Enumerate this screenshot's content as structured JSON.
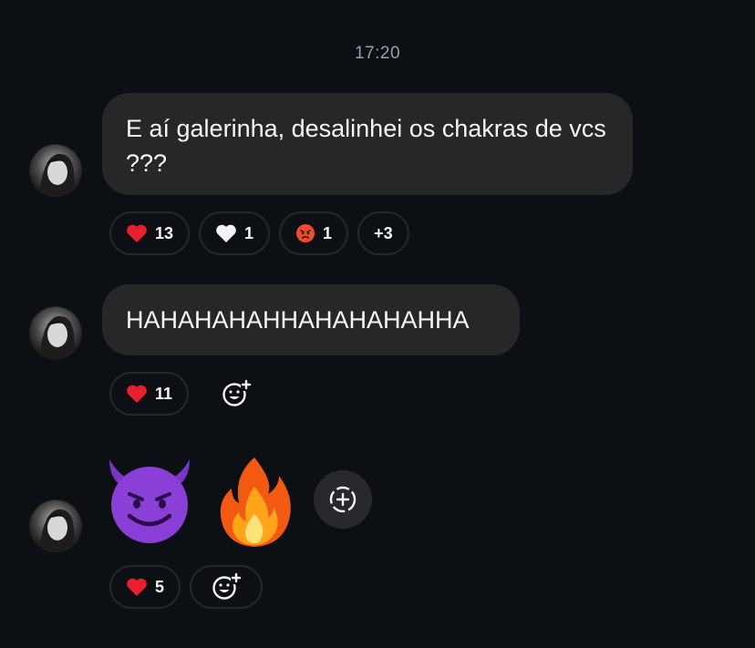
{
  "timestamp": "17:20",
  "messages": [
    {
      "text": "E aí galerinha, desalinhei os chakras de vcs ???",
      "reactions": [
        {
          "emoji": "red-heart",
          "count": "13"
        },
        {
          "emoji": "white-heart",
          "count": "1"
        },
        {
          "emoji": "angry-face",
          "count": "1"
        },
        {
          "emoji": "none",
          "count": "+3"
        }
      ]
    },
    {
      "text": "HAHAHAHAHHAHAHAHAHHA",
      "reactions": [
        {
          "emoji": "red-heart",
          "count": "11"
        }
      ]
    },
    {
      "emoji_message": [
        "smiling-devil-emoji",
        "fire-emoji"
      ],
      "reactions": [
        {
          "emoji": "red-heart",
          "count": "5"
        }
      ]
    }
  ],
  "colors": {
    "background": "#0c0f14",
    "bubble": "#262729",
    "chip_border": "#24272c",
    "muted_text": "#9aa0a8"
  }
}
